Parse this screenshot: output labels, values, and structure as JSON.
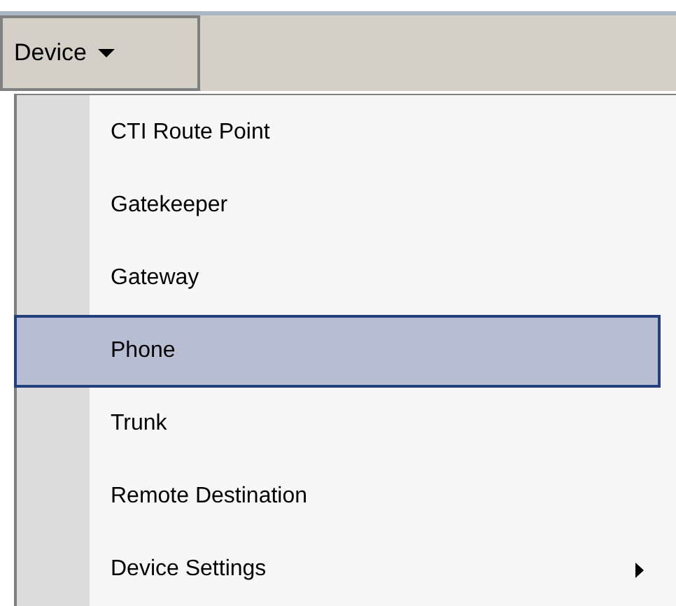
{
  "menu_bar": {
    "menu": {
      "label": "Device",
      "expanded": true
    }
  },
  "dropdown": {
    "items": [
      {
        "label": "CTI Route Point",
        "selected": false,
        "has_submenu": false
      },
      {
        "label": "Gatekeeper",
        "selected": false,
        "has_submenu": false
      },
      {
        "label": "Gateway",
        "selected": false,
        "has_submenu": false
      },
      {
        "label": "Phone",
        "selected": true,
        "has_submenu": false
      },
      {
        "label": "Trunk",
        "selected": false,
        "has_submenu": false
      },
      {
        "label": "Remote Destination",
        "selected": false,
        "has_submenu": false
      },
      {
        "label": "Device Settings",
        "selected": false,
        "has_submenu": true
      }
    ]
  }
}
